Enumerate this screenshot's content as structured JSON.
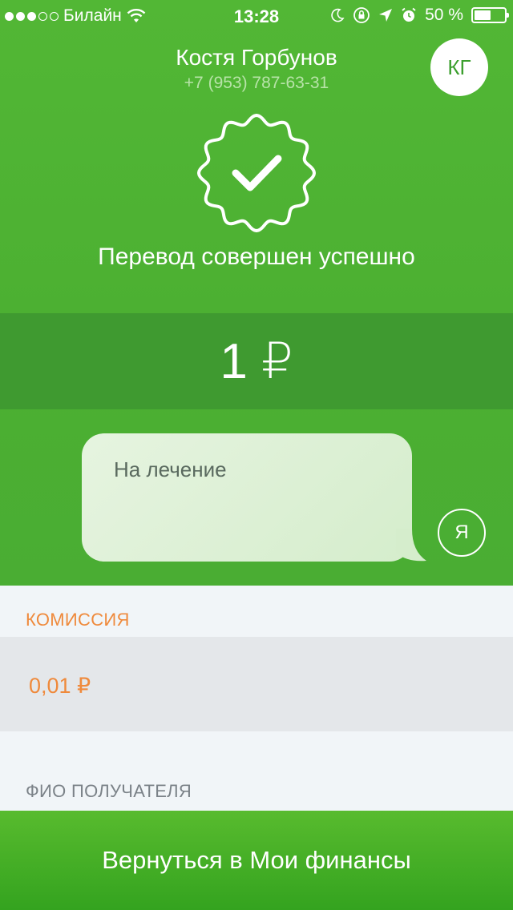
{
  "status_bar": {
    "carrier": "Билайн",
    "time": "13:28",
    "battery": "50 %"
  },
  "contact": {
    "name": "Костя Горбунов",
    "phone": "+7 (953) 787-63-31",
    "initials": "КГ"
  },
  "result": {
    "message": "Перевод совершен успешно",
    "amount": "1 ₽"
  },
  "comment": {
    "text": "На лечение",
    "sender_initial": "Я"
  },
  "details": {
    "commission_label": "КОМИССИЯ",
    "commission_value": "0,01 ₽",
    "recipient_label": "ФИО ПОЛУЧАТЕЛЯ"
  },
  "footer": {
    "button_label": "Вернуться в Мои финансы"
  },
  "colors": {
    "brand_green": "#4cb032",
    "amount_band": "#3f9a30",
    "accent_orange": "#ef8a3c"
  },
  "icons": [
    "wifi-icon",
    "moon-icon",
    "orientation-lock-icon",
    "location-icon",
    "alarm-icon",
    "battery-icon",
    "success-badge-icon",
    "checkmark-icon"
  ]
}
